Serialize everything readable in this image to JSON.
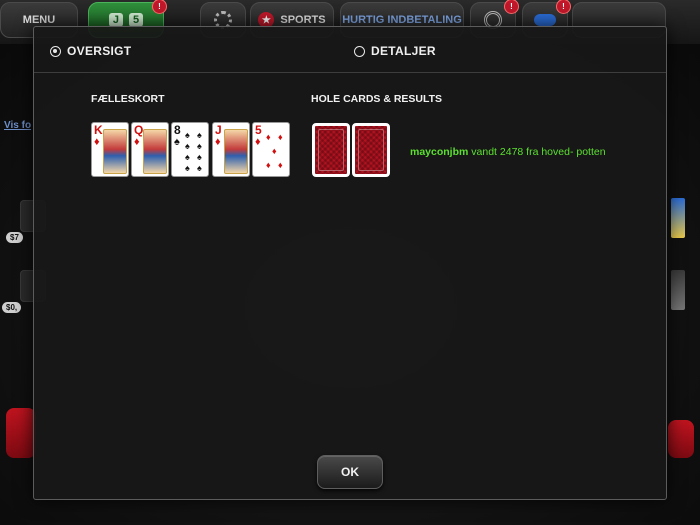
{
  "topbar": {
    "menu_label": "MENU",
    "table_count_left": "J",
    "table_count_right": "5",
    "table_badge": "!",
    "sports_label": "SPORTS",
    "deposit_label": "HURTIG INDBETALING",
    "badge_mark": "!"
  },
  "background": {
    "vis_link": "Vis fo",
    "chip_1": "$7",
    "chip_2": "$0,"
  },
  "modal": {
    "tabs": [
      {
        "label": "OVERSIGT",
        "selected": true
      },
      {
        "label": "DETALJER",
        "selected": false
      }
    ],
    "community_heading": "FÆLLESKORT",
    "hole_heading": "HOLE CARDS & RESULTS",
    "community_cards": [
      {
        "rank": "K",
        "suit": "♦",
        "color": "red",
        "face": true
      },
      {
        "rank": "Q",
        "suit": "♦",
        "color": "red",
        "face": true
      },
      {
        "rank": "8",
        "suit": "♠",
        "color": "black",
        "face": false
      },
      {
        "rank": "J",
        "suit": "♦",
        "color": "red",
        "face": true
      },
      {
        "rank": "5",
        "suit": "♦",
        "color": "red",
        "face": false
      }
    ],
    "result": {
      "player": "mayconjbm",
      "text": "vandt 2478 fra hoved- potten"
    },
    "ok_label": "OK"
  },
  "colors": {
    "accent_green": "#5be02f",
    "card_back_red": "#b0121f",
    "modal_bg": "#181818"
  }
}
